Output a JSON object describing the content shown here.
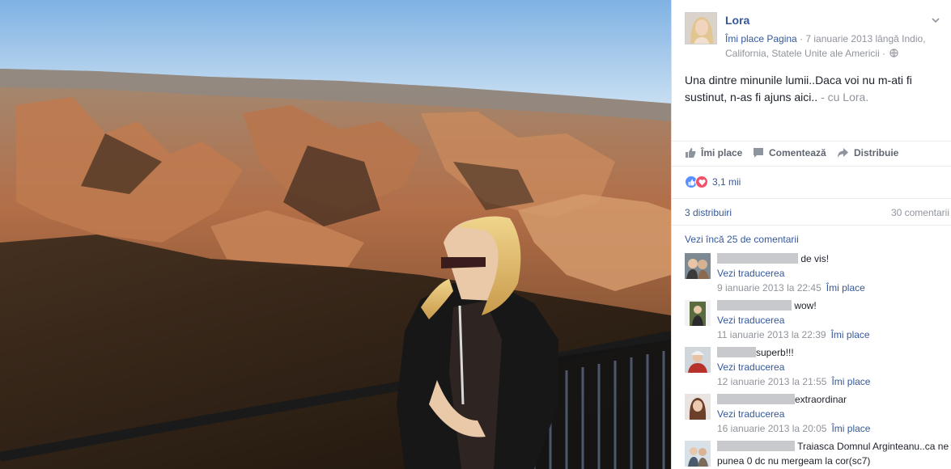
{
  "post": {
    "author": "Lora",
    "like_page": "Îmi place Pagina",
    "meta_rest": " · 7 ianuarie 2013 lângă Indio, California, Statele Unite ale Americii ·",
    "caption": "Una dintre minunile lumii..Daca voi nu m-ati fi sustinut, n-as fi ajuns aici..",
    "caption_with": "- cu Lora."
  },
  "actions": {
    "like": "Îmi place",
    "comment": "Comentează",
    "share": "Distribuie"
  },
  "reactions": {
    "count": "3,1 mii"
  },
  "counts": {
    "shares": "3 distribuiri",
    "comments": "30 comentarii"
  },
  "more_comments": "Vezi încă 25 de comentarii",
  "comments": [
    {
      "text": "de vis!",
      "translate": "Vezi traducerea",
      "time": "9 ianuarie 2013 la 22:45",
      "like": "Îmi place"
    },
    {
      "text": "wow!",
      "translate": "Vezi traducerea",
      "time": "11 ianuarie 2013 la 22:39",
      "like": "Îmi place"
    },
    {
      "text": "superb!!!",
      "translate": "Vezi traducerea",
      "time": "12 ianuarie 2013 la 21:55",
      "like": "Îmi place"
    },
    {
      "text": "extraordinar",
      "translate": "Vezi traducerea",
      "time": "16 ianuarie 2013 la 20:05",
      "like": "Îmi place"
    },
    {
      "text": "Traiasca Domnul Arginteanu..ca ne punea 0 dc nu mergeam la cor(sc7)"
    }
  ],
  "colors": {
    "link": "#365899",
    "muted": "#90949c",
    "text": "#1d2129",
    "like_blue": "#5890ff",
    "love_red": "#f25268"
  },
  "icons": [
    "chevron-down-icon",
    "globe-icon",
    "thumbs-up-icon",
    "comment-bubble-icon",
    "share-arrow-icon",
    "like-reaction-icon",
    "love-reaction-icon"
  ]
}
